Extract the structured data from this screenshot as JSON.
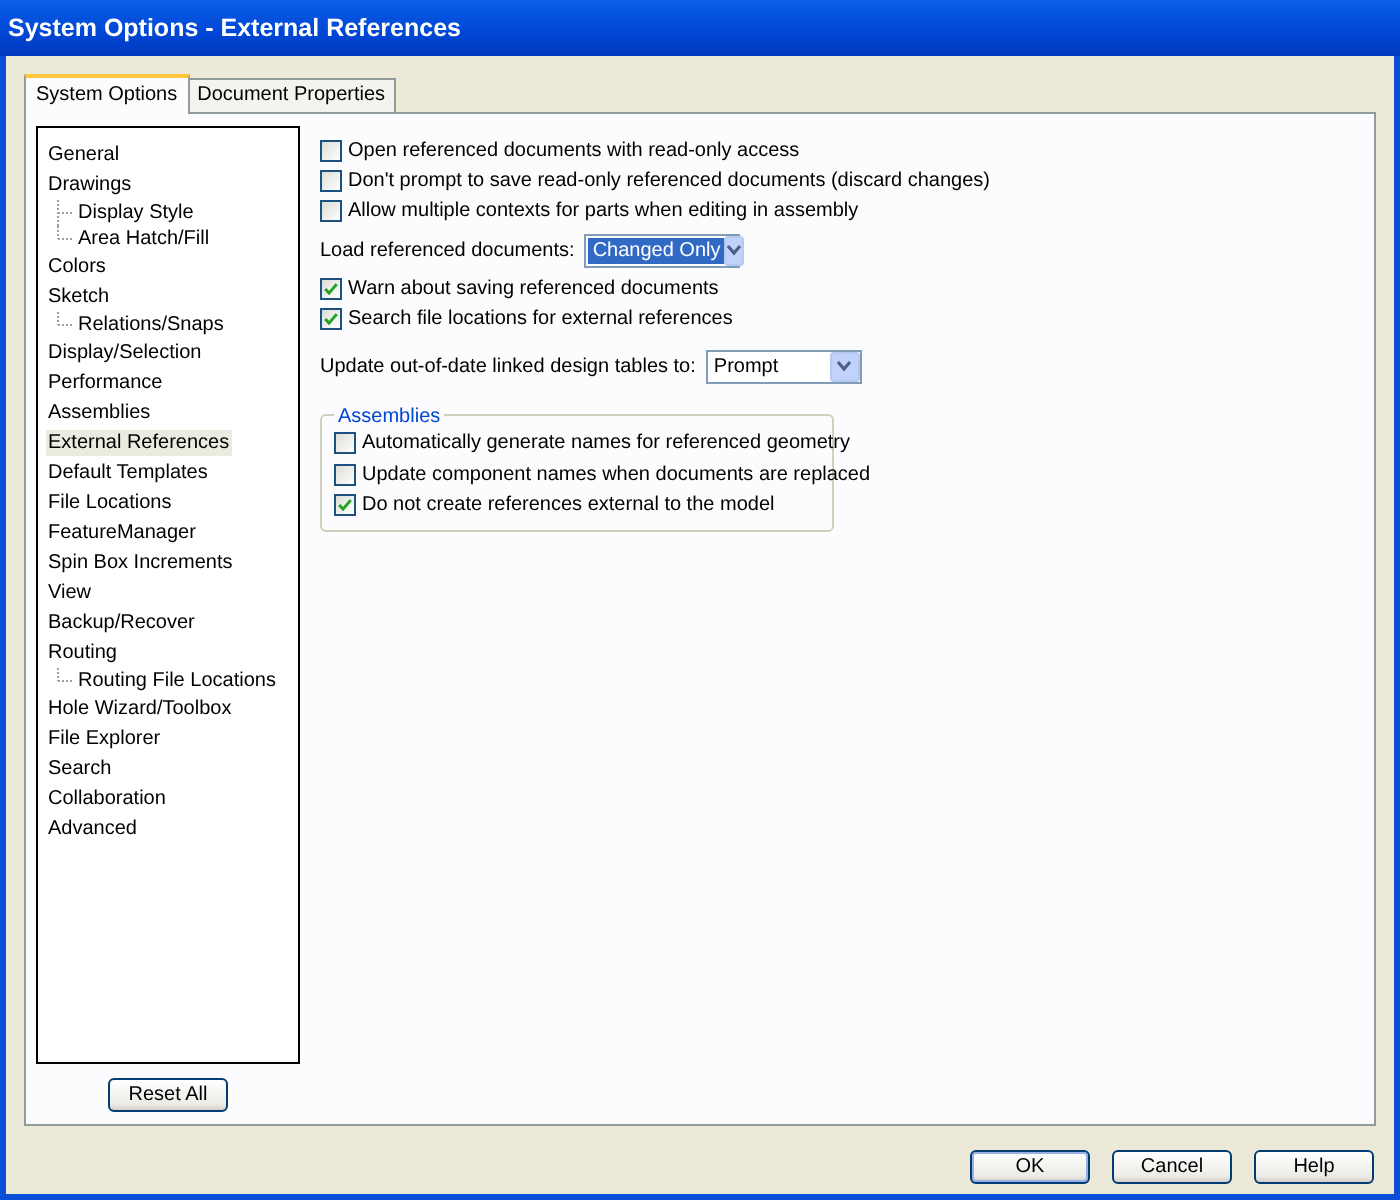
{
  "window": {
    "title": "System Options - External References"
  },
  "tabs": [
    {
      "label": "System Options",
      "selected": true
    },
    {
      "label": "Document Properties",
      "selected": false
    }
  ],
  "tree": [
    {
      "label": "General",
      "selected": false
    },
    {
      "label": "Drawings",
      "selected": false,
      "children": [
        {
          "label": "Display Style",
          "selected": false
        },
        {
          "label": "Area Hatch/Fill",
          "selected": false
        }
      ]
    },
    {
      "label": "Colors",
      "selected": false
    },
    {
      "label": "Sketch",
      "selected": false,
      "children": [
        {
          "label": "Relations/Snaps",
          "selected": false
        }
      ]
    },
    {
      "label": "Display/Selection",
      "selected": false
    },
    {
      "label": "Performance",
      "selected": false
    },
    {
      "label": "Assemblies",
      "selected": false
    },
    {
      "label": "External References",
      "selected": true
    },
    {
      "label": "Default Templates",
      "selected": false
    },
    {
      "label": "File Locations",
      "selected": false
    },
    {
      "label": "FeatureManager",
      "selected": false
    },
    {
      "label": "Spin Box Increments",
      "selected": false
    },
    {
      "label": "View",
      "selected": false
    },
    {
      "label": "Backup/Recover",
      "selected": false
    },
    {
      "label": "Routing",
      "selected": false,
      "children": [
        {
          "label": "Routing File Locations",
          "selected": false
        }
      ]
    },
    {
      "label": "Hole Wizard/Toolbox",
      "selected": false
    },
    {
      "label": "File Explorer",
      "selected": false
    },
    {
      "label": "Search",
      "selected": false
    },
    {
      "label": "Collaboration",
      "selected": false
    },
    {
      "label": "Advanced",
      "selected": false
    }
  ],
  "reset_button": "Reset All",
  "options": [
    {
      "kind": "checkbox",
      "label": "Open referenced documents with read-only access",
      "checked": false
    },
    {
      "kind": "checkbox",
      "label": "Don't prompt to save read-only referenced documents (discard changes)",
      "checked": false
    },
    {
      "kind": "checkbox",
      "label": "Allow multiple contexts for parts when editing in assembly",
      "checked": false
    },
    {
      "kind": "dropdown",
      "label": "Load referenced documents:",
      "value": "Changed Only",
      "focused": true
    },
    {
      "kind": "checkbox",
      "label": "Warn about saving referenced documents",
      "checked": true
    },
    {
      "kind": "checkbox",
      "label": "Search file locations for external references",
      "checked": true
    },
    {
      "kind": "dropdown",
      "label": "Update out-of-date linked design tables to:",
      "value": "Prompt",
      "focused": false
    }
  ],
  "assemblies": {
    "title": "Assemblies",
    "options": [
      {
        "label": "Automatically generate names for referenced geometry",
        "checked": false
      },
      {
        "label": "Update component names when documents are replaced",
        "checked": false
      },
      {
        "label": "Do not create references external to the model",
        "checked": true
      }
    ]
  },
  "buttons": [
    {
      "label": "OK",
      "default": true
    },
    {
      "label": "Cancel",
      "default": false
    },
    {
      "label": "Help",
      "default": false
    }
  ]
}
